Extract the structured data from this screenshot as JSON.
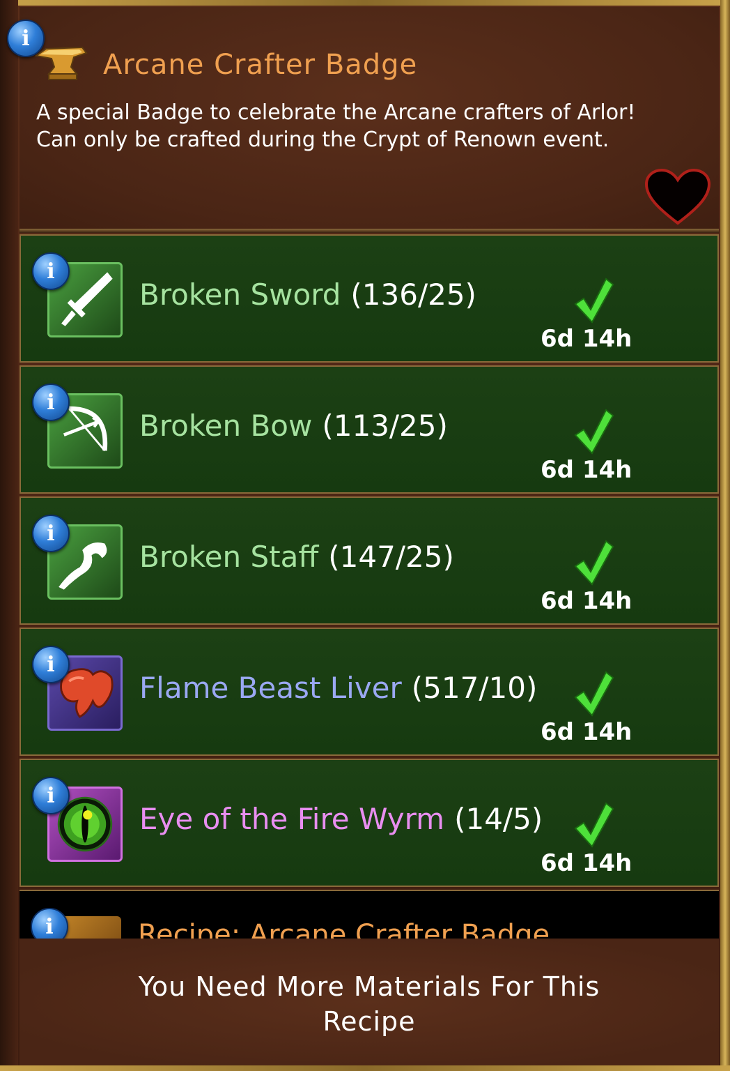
{
  "header": {
    "title": "Arcane Crafter Badge",
    "description_line1": "A special Badge to celebrate the Arcane crafters of Arlor!",
    "description_line2": "Can only be crafted during the Crypt of Renown event.",
    "info_glyph": "i",
    "icon": "anvil-icon",
    "favorite_icon": "heart-icon"
  },
  "materials": [
    {
      "name": "Broken Sword",
      "count": "(136/25)",
      "timer": "6d 14h",
      "name_color": "#a6e3a0",
      "icon": "broken-sword-icon",
      "status": "complete"
    },
    {
      "name": "Broken Bow",
      "count": "(113/25)",
      "timer": "6d 14h",
      "name_color": "#a6e3a0",
      "icon": "broken-bow-icon",
      "status": "complete"
    },
    {
      "name": "Broken Staff",
      "count": "(147/25)",
      "timer": "6d 14h",
      "name_color": "#a6e3a0",
      "icon": "broken-staff-icon",
      "status": "complete"
    },
    {
      "name": "Flame Beast Liver",
      "count": "(517/10)",
      "timer": "6d 14h",
      "name_color": "#9aa8f2",
      "icon": "liver-icon",
      "status": "complete"
    },
    {
      "name": "Eye of the Fire Wyrm",
      "count": "(14/5)",
      "timer": "6d 14h",
      "name_color": "#e88ef0",
      "icon": "dragon-eye-icon",
      "status": "complete"
    }
  ],
  "recipe": {
    "label": "Recipe: Arcane Crafter Badge",
    "icon": "recipe-scroll-icon"
  },
  "footer": {
    "message_line1": "You Need More Materials For This",
    "message_line2": "Recipe"
  },
  "colors": {
    "title": "#f0a050",
    "check": "#4ee03a",
    "row_bg": "#163a10"
  }
}
